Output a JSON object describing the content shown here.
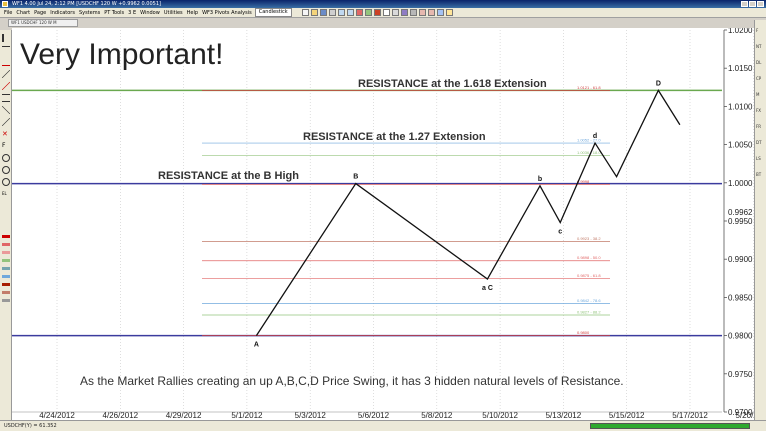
{
  "window": {
    "title": "WF1 4.00 Jul 24, 2:12 PM   [USDCHF 120  W  +0.9962  0.0051]"
  },
  "menu": {
    "items": [
      "File",
      "Chart",
      "Page",
      "Indicators",
      "Systems",
      "PT Tools",
      "3 E",
      "Window",
      "Utilities",
      "Help",
      "WF3 Pivots Analysis"
    ],
    "active_tab": "Candlestick"
  },
  "doc_tab": "WF1  USDCHF 120  W  M",
  "annotations": {
    "title": "Very Important!",
    "resistance_1618": "RESISTANCE at the 1.618 Extension",
    "resistance_127": "RESISTANCE at the 1.27 Extension",
    "resistance_b_high": "RESISTANCE at the B High",
    "caption": "As the Market Rallies creating an up A,B,C,D Price Swing, it has 3 hidden natural levels of Resistance."
  },
  "statusbar": {
    "text": "USDCHF(Y) = 61.352"
  },
  "right_toolbar": [
    "F",
    "NT",
    "DL",
    "CP",
    "M",
    "FX",
    "FR",
    "DT",
    "LS",
    "BT"
  ],
  "chart_data": {
    "type": "line",
    "symbol": "USDCHF",
    "x_tick_labels": [
      "4/24/2012",
      "4/26/2012",
      "4/29/2012",
      "5/1/2012",
      "5/3/2012",
      "5/6/2012",
      "5/8/2012",
      "5/10/2012",
      "5/13/2012",
      "5/15/2012",
      "5/17/2012",
      "5/20/2012"
    ],
    "ylim": [
      0.97,
      1.02
    ],
    "y_tick_labels": [
      "1.0200",
      "1.0150",
      "1.0100",
      "1.0050",
      "1.0000",
      "0.9950",
      "0.9900",
      "0.9850",
      "0.9800",
      "0.9750",
      "0.9700"
    ],
    "y_ticks": [
      1.02,
      1.015,
      1.01,
      1.005,
      1.0,
      0.995,
      0.99,
      0.985,
      0.98,
      0.975,
      0.97
    ],
    "current_price_label": "0.9962",
    "current_price": 0.9962,
    "swing": [
      {
        "x": 3.15,
        "y": 0.98,
        "label": "A"
      },
      {
        "x": 4.72,
        "y": 0.9999,
        "label": "B"
      },
      {
        "x": 6.8,
        "y": 0.9874,
        "label": "a C"
      },
      {
        "x": 7.63,
        "y": 0.9996,
        "label": "b"
      },
      {
        "x": 7.95,
        "y": 0.9948,
        "label": "c"
      },
      {
        "x": 8.5,
        "y": 1.0052,
        "label": "d"
      },
      {
        "x": 8.84,
        "y": 1.0008,
        "label": ""
      },
      {
        "x": 9.5,
        "y": 1.0121,
        "label": "D"
      },
      {
        "x": 9.84,
        "y": 1.0076,
        "label": ""
      }
    ],
    "hlines": [
      {
        "y": 1.0121,
        "color": "#6aa84f",
        "width": 1.5,
        "full": true
      },
      {
        "y": 0.9999,
        "color": "#3b3b9e",
        "width": 1.5,
        "full": true
      },
      {
        "y": 0.98,
        "color": "#3b3b9e",
        "width": 1.5,
        "full": true
      }
    ],
    "levels": [
      {
        "y": 1.0121,
        "label": "1.0121 - 61.8",
        "color": "#d04040"
      },
      {
        "y": 1.0052,
        "label": "1.0052 - 27.0",
        "color": "#6fa8dc"
      },
      {
        "y": 1.0036,
        "label": "1.0036 - 18.0",
        "color": "#93c47d"
      },
      {
        "y": 0.9998,
        "label": "0.9998",
        "color": "#d04040"
      },
      {
        "y": 0.9923,
        "label": "0.9923 - 38.2",
        "color": "#c27c6a"
      },
      {
        "y": 0.9898,
        "label": "0.9898 - 50.0",
        "color": "#e06666"
      },
      {
        "y": 0.9875,
        "label": "0.9875 - 61.8",
        "color": "#e06666"
      },
      {
        "y": 0.9842,
        "label": "0.9842 - 78.6",
        "color": "#6fa8dc"
      },
      {
        "y": 0.9827,
        "label": "0.9827 - 88.2",
        "color": "#93c47d"
      },
      {
        "y": 0.98,
        "label": "0.9800",
        "color": "#d04040"
      }
    ]
  }
}
